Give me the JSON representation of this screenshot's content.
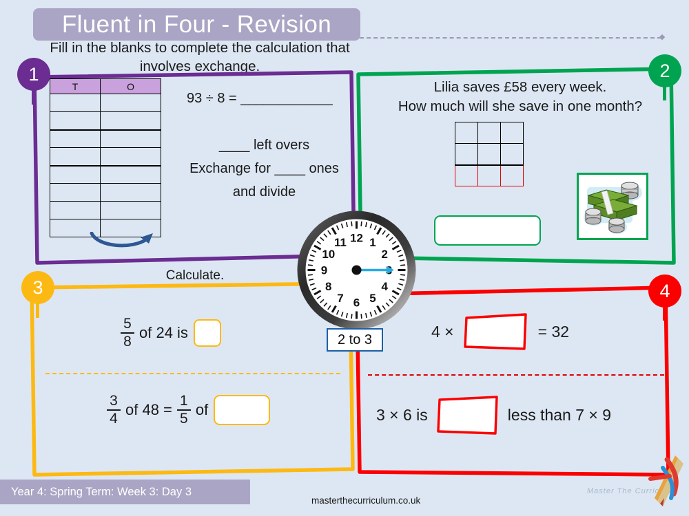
{
  "page": {
    "background_color": "#dde7f3",
    "title": "Fluent in Four - Revision",
    "instruction": "Fill in the blanks to complete the calculation that involves exchange."
  },
  "footer": {
    "banner_label": "Year 4: Spring Term: Week 3: Day 3",
    "url": "masterthecurriculum.co.uk",
    "brand": "Master  The  Curriculum",
    "logo_icon": "pencil-icon"
  },
  "clock": {
    "name": "analogue-clock",
    "numerals": [
      "1",
      "2",
      "3",
      "4",
      "5",
      "6",
      "7",
      "8",
      "9",
      "10",
      "11",
      "12"
    ],
    "hand_icon": "blue-arrow-hand",
    "label": "2 to 3",
    "label_border_color": "#1d5fa8",
    "hand_color": "#29abe2"
  },
  "questions": [
    {
      "number": "1",
      "color": "#6b2d92",
      "table": {
        "headers": [
          "T",
          "O"
        ],
        "row_count": 8
      },
      "arrow_icon": "exchange-curve-arrow",
      "lines": [
        "93 ÷ 8 = ____________",
        "____ left overs",
        "Exchange for ____ ones",
        "and divide"
      ]
    },
    {
      "number": "2",
      "color": "#00a450",
      "text": "Lilia saves £58 every week. How much will she save in one month?",
      "text_line1": "Lilia saves £58 every week.",
      "text_line2": "How much will she save in one month?",
      "grid": {
        "columns": 3,
        "rows": 3,
        "highlight_row_index": 2,
        "highlight_color": "#e00000"
      },
      "answer_box": {
        "value": "",
        "border_color": "#00a450"
      },
      "image_icon": "money-stack-icon"
    },
    {
      "number": "3",
      "color": "#fdb913",
      "heading": "Calculate.",
      "rows": [
        {
          "fraction": {
            "numerator": "5",
            "denominator": "8"
          },
          "text_after": "of 24 is",
          "answer_box": {
            "value": "",
            "size": "small"
          }
        },
        {
          "fraction": {
            "numerator": "3",
            "denominator": "4"
          },
          "text_after": "of 48 =",
          "fraction2": {
            "numerator": "1",
            "denominator": "5"
          },
          "text_after2": "of",
          "answer_box": {
            "value": "",
            "size": "large"
          }
        }
      ]
    },
    {
      "number": "4",
      "color": "#fa0000",
      "rows": [
        {
          "text_before": "4 ×",
          "answer_box": {
            "value": ""
          },
          "text_after": "= 32"
        },
        {
          "text_before": "3 × 6 is",
          "answer_box": {
            "value": ""
          },
          "text_after": "less than 7 × 9"
        }
      ]
    }
  ]
}
